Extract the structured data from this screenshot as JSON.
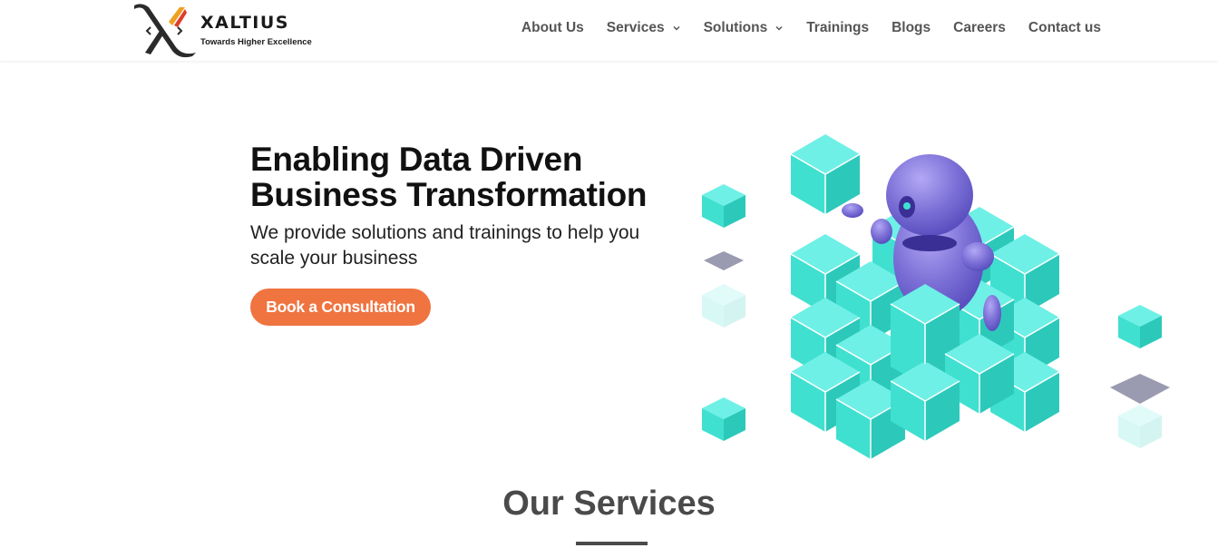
{
  "brand": {
    "name": "XALTIUS",
    "tagline": "Towards Higher Excellence"
  },
  "nav": {
    "items": [
      {
        "label": "About Us",
        "dropdown": false
      },
      {
        "label": "Services",
        "dropdown": true
      },
      {
        "label": "Solutions",
        "dropdown": true
      },
      {
        "label": "Trainings",
        "dropdown": false
      },
      {
        "label": "Blogs",
        "dropdown": false
      },
      {
        "label": "Careers",
        "dropdown": false
      },
      {
        "label": "Contact us",
        "dropdown": false
      }
    ]
  },
  "hero": {
    "title_line1": "Enabling Data Driven",
    "title_line2": "Business Transformation",
    "subtitle": "We provide solutions and trainings to help you scale your business",
    "cta_label": "Book a Consultation",
    "illustration": "robot-on-cubes-illustration"
  },
  "services": {
    "heading": "Our Services"
  },
  "colors": {
    "accent": "#ef7440",
    "cube": "#40e0d0",
    "robot": "#7b6fd6",
    "nav_text": "#555555"
  }
}
